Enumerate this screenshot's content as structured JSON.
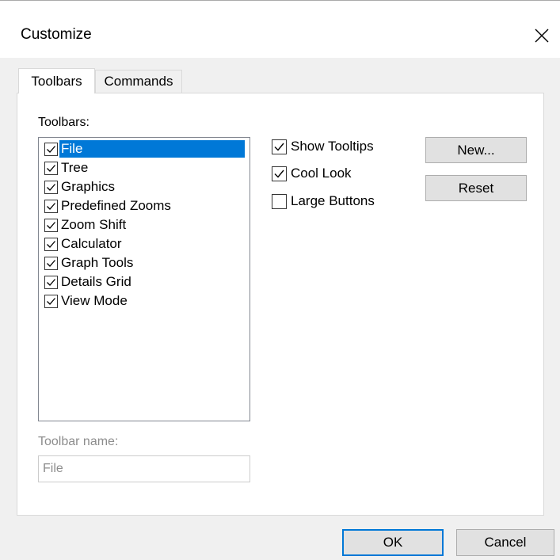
{
  "window": {
    "title": "Customize"
  },
  "tabs": [
    {
      "label": "Toolbars",
      "active": true
    },
    {
      "label": "Commands",
      "active": false
    }
  ],
  "toolbars_panel": {
    "list_label": "Toolbars:",
    "items": [
      {
        "label": "File",
        "checked": true,
        "selected": true
      },
      {
        "label": "Tree",
        "checked": true,
        "selected": false
      },
      {
        "label": "Graphics",
        "checked": true,
        "selected": false
      },
      {
        "label": "Predefined Zooms",
        "checked": true,
        "selected": false
      },
      {
        "label": "Zoom Shift",
        "checked": true,
        "selected": false
      },
      {
        "label": "Calculator",
        "checked": true,
        "selected": false
      },
      {
        "label": "Graph Tools",
        "checked": true,
        "selected": false
      },
      {
        "label": "Details Grid",
        "checked": true,
        "selected": false
      },
      {
        "label": "View Mode",
        "checked": true,
        "selected": false
      }
    ],
    "options": [
      {
        "label": "Show Tooltips",
        "checked": true
      },
      {
        "label": "Cool Look",
        "checked": true
      },
      {
        "label": "Large Buttons",
        "checked": false
      }
    ],
    "new_button": "New...",
    "reset_button": "Reset",
    "name_label": "Toolbar name:",
    "name_value": "File"
  },
  "footer": {
    "ok": "OK",
    "cancel": "Cancel"
  },
  "colors": {
    "selection": "#0078d7",
    "default_button_border": "#0078d7",
    "disabled_text": "#8d8d8d"
  },
  "icons": {
    "close": "close-icon",
    "check": "checkmark-icon"
  }
}
